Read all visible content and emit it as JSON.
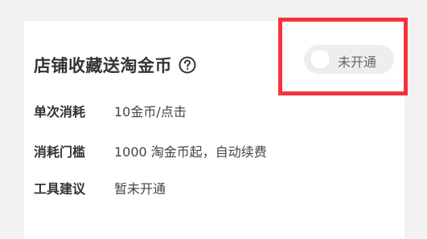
{
  "card": {
    "title": "店铺收藏送淘金币",
    "toggle": {
      "label": "未开通",
      "on": false
    },
    "rows": [
      {
        "key": "单次消耗",
        "value": "10金币/点击"
      },
      {
        "key": "消耗门槛",
        "value": "1000 淘金币起，自动续费"
      },
      {
        "key": "工具建议",
        "value": "暂未开通"
      }
    ]
  },
  "colors": {
    "highlight": "#f5323c",
    "toggle_bg": "#eeeeee",
    "text": "#333333"
  },
  "icons": {
    "help": "help-icon"
  }
}
